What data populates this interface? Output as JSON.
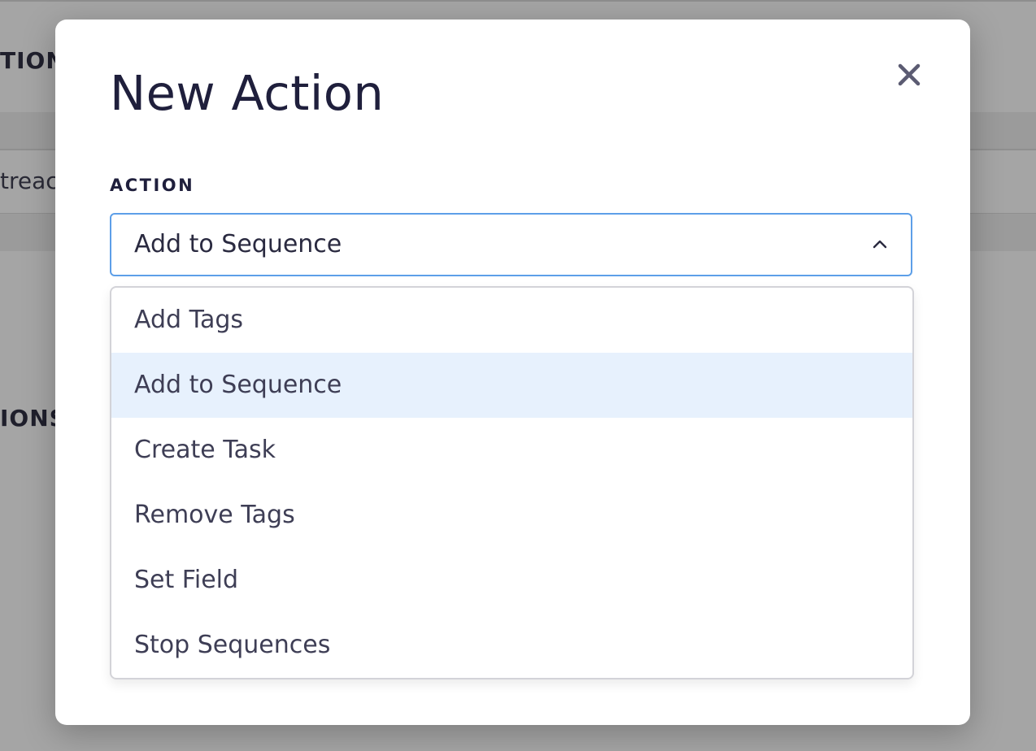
{
  "background": {
    "heading_1": "TION",
    "cell_1": "treac",
    "heading_2": "IONS"
  },
  "modal": {
    "title": "New Action",
    "close_icon": "close-icon",
    "field_label": "ACTION",
    "select": {
      "value": "Add to Sequence",
      "chevron_icon": "chevron-up-icon"
    },
    "options": [
      {
        "label": "Add Tags",
        "highlighted": false
      },
      {
        "label": "Add to Sequence",
        "highlighted": true
      },
      {
        "label": "Create Task",
        "highlighted": false
      },
      {
        "label": "Remove Tags",
        "highlighted": false
      },
      {
        "label": "Set Field",
        "highlighted": false
      },
      {
        "label": "Stop Sequences",
        "highlighted": false
      }
    ]
  },
  "colors": {
    "accent_border": "#5d9fe8",
    "highlight_bg": "#e7f1fd",
    "title_text": "#1f1f3c"
  }
}
